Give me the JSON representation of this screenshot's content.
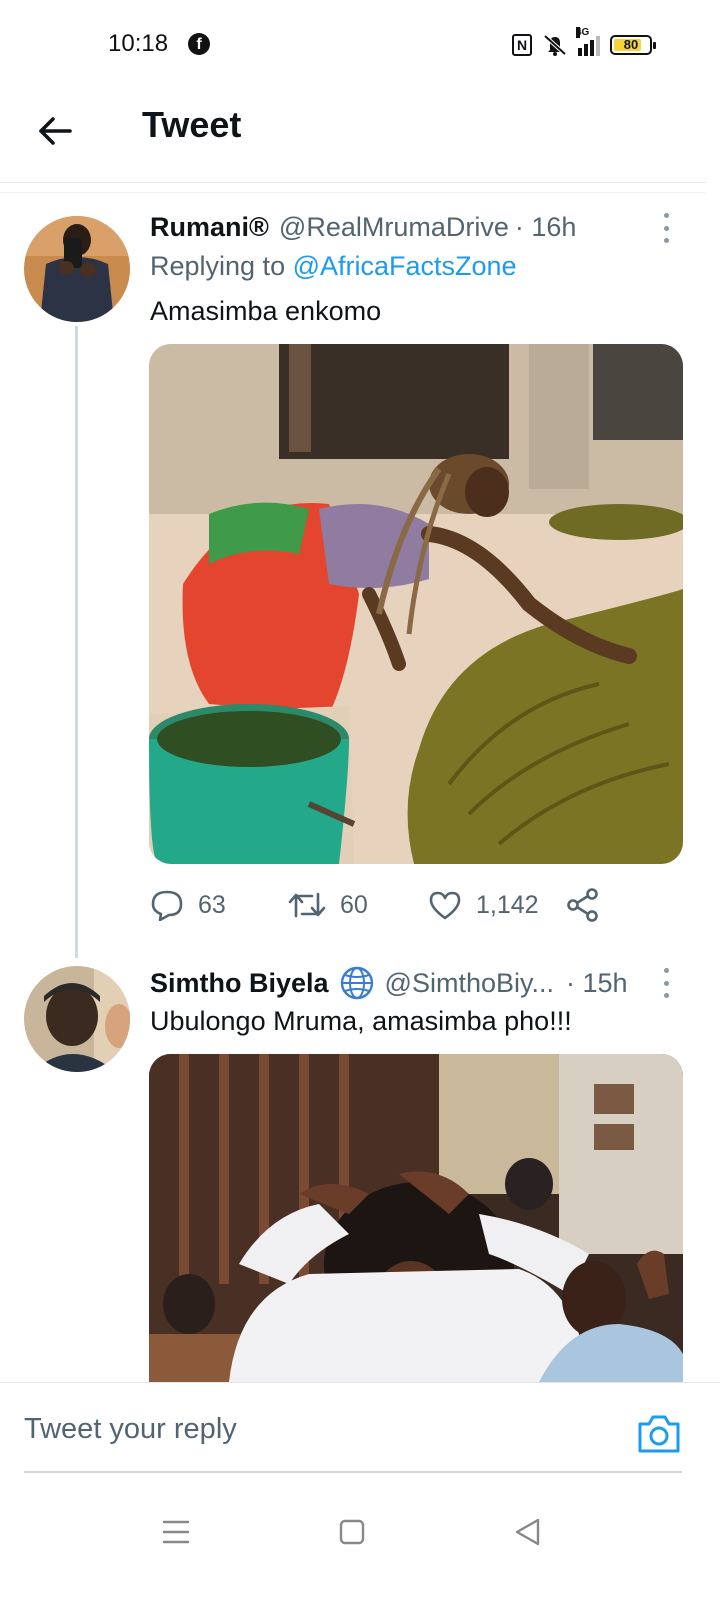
{
  "status_bar": {
    "time": "10:18",
    "battery": "80",
    "network": "4G",
    "icons": [
      "facebook-icon",
      "nfc-icon",
      "mute-icon",
      "signal-icon",
      "battery-icon"
    ]
  },
  "header": {
    "title": "Tweet",
    "back_icon": "arrow-left-icon"
  },
  "tweets": [
    {
      "name": "Rumani®",
      "handle": "@RealMrumaDrive",
      "time": "· 16h",
      "replying_prefix": "Replying to ",
      "replying_to": "@AfricaFactsZone",
      "text": "Amasimba enkomo",
      "media": "Woman kneeling and smearing cow dung on the ground beside a green bucket",
      "stats": {
        "replies": "63",
        "retweets": "60",
        "likes": "1,142"
      }
    },
    {
      "name": "Simtho Biyela",
      "handle": "@SimthoBiy...",
      "time": "· 15h",
      "text": "Ubulongo Mruma, amasimba pho!!!",
      "media": "Woman in a white shirt with hands on her head in a restaurant"
    }
  ],
  "reply_bar": {
    "placeholder": "Tweet your reply",
    "camera_icon": "camera-icon"
  },
  "nav_bar": {
    "icons": [
      "menu-icon",
      "home-square-icon",
      "back-triangle-icon"
    ]
  },
  "colors": {
    "accent": "#1d9bf0",
    "text_primary": "#0f1419",
    "text_secondary": "#536471",
    "battery_fill": "#f6d43a"
  }
}
